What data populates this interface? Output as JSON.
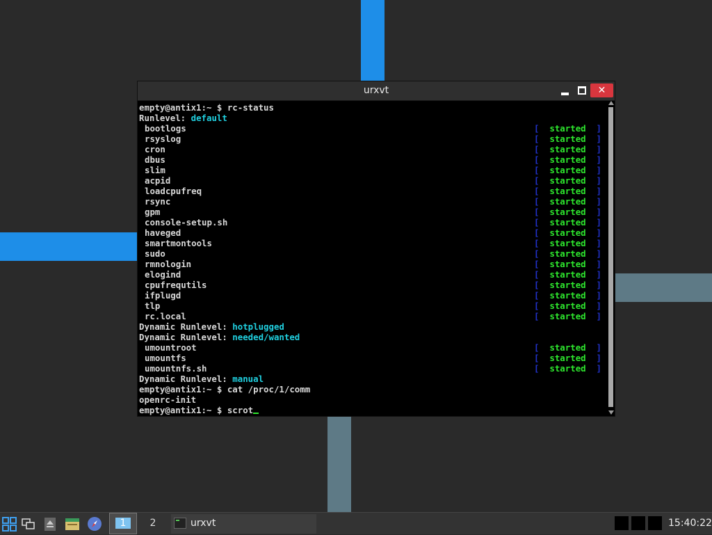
{
  "window": {
    "title": "urxvt"
  },
  "terminal": {
    "lines": [
      {
        "type": "plain",
        "text": "empty@antix1:~ $ rc-status"
      },
      {
        "type": "label",
        "label": "Runlevel: ",
        "value": "default"
      },
      {
        "type": "service",
        "name": "bootlogs",
        "status": "started"
      },
      {
        "type": "service",
        "name": "rsyslog",
        "status": "started"
      },
      {
        "type": "service",
        "name": "cron",
        "status": "started"
      },
      {
        "type": "service",
        "name": "dbus",
        "status": "started"
      },
      {
        "type": "service",
        "name": "slim",
        "status": "started"
      },
      {
        "type": "service",
        "name": "acpid",
        "status": "started"
      },
      {
        "type": "service",
        "name": "loadcpufreq",
        "status": "started"
      },
      {
        "type": "service",
        "name": "rsync",
        "status": "started"
      },
      {
        "type": "service",
        "name": "gpm",
        "status": "started"
      },
      {
        "type": "service",
        "name": "console-setup.sh",
        "status": "started"
      },
      {
        "type": "service",
        "name": "haveged",
        "status": "started"
      },
      {
        "type": "service",
        "name": "smartmontools",
        "status": "started"
      },
      {
        "type": "service",
        "name": "sudo",
        "status": "started"
      },
      {
        "type": "service",
        "name": "rmnologin",
        "status": "started"
      },
      {
        "type": "service",
        "name": "elogind",
        "status": "started"
      },
      {
        "type": "service",
        "name": "cpufrequtils",
        "status": "started"
      },
      {
        "type": "service",
        "name": "ifplugd",
        "status": "started"
      },
      {
        "type": "service",
        "name": "tlp",
        "status": "started"
      },
      {
        "type": "service",
        "name": "rc.local",
        "status": "started"
      },
      {
        "type": "label",
        "label": "Dynamic Runlevel: ",
        "value": "hotplugged"
      },
      {
        "type": "label",
        "label": "Dynamic Runlevel: ",
        "value": "needed/wanted"
      },
      {
        "type": "service",
        "name": "umountroot",
        "status": "started"
      },
      {
        "type": "service",
        "name": "umountfs",
        "status": "started"
      },
      {
        "type": "service",
        "name": "umountnfs.sh",
        "status": "started"
      },
      {
        "type": "label",
        "label": "Dynamic Runlevel: ",
        "value": "manual"
      },
      {
        "type": "plain",
        "text": "empty@antix1:~ $ cat /proc/1/comm"
      },
      {
        "type": "plain",
        "text": "openrc-init"
      },
      {
        "type": "prompt",
        "text": "empty@antix1:~ $ scrot"
      }
    ],
    "bracket_open": "[",
    "bracket_close": "]"
  },
  "taskbar": {
    "workspace_1": "1",
    "workspace_2": "2",
    "task_label": "urxvt",
    "clock": "15:40:22"
  },
  "icons": {
    "menu": "menu-grid-icon",
    "show_desktop": "windows-icon",
    "eject": "eject-icon",
    "files": "file-manager-icon",
    "browser": "browser-compass-icon",
    "terminal": "terminal-icon",
    "close": "✕"
  },
  "colors": {
    "accent_blue": "#1e8ee8",
    "slate": "#5e7a86",
    "status_green": "#2ee82e",
    "label_cyan": "#20d0e0",
    "close_red": "#d9363e"
  }
}
